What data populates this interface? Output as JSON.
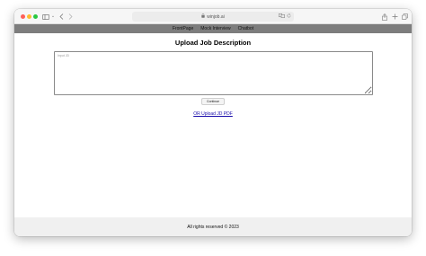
{
  "browser": {
    "url": "winjob.ai",
    "icons": {
      "sidebar": "sidebar-toggle-icon",
      "back": "chevron-left-icon",
      "forward": "chevron-right-icon",
      "lock": "lock-icon",
      "translate": "translate-icon",
      "reload": "reload-icon",
      "share": "share-icon",
      "new_tab": "plus-icon",
      "tabs": "tab-overview-icon"
    }
  },
  "nav": {
    "items": [
      {
        "label": "FrontPage"
      },
      {
        "label": "Mock Interview"
      },
      {
        "label": "Chatbot"
      }
    ]
  },
  "main": {
    "title": "Upload Job Description",
    "textarea_placeholder": "Input JD",
    "continue_label": "Continue",
    "upload_link": "OR Upload JD PDF"
  },
  "footer": {
    "text": "All rights reserved © 2023"
  },
  "colors": {
    "navbar": "#7d7d7d",
    "footer": "#f0f0f0",
    "link": "#1a0dab"
  }
}
